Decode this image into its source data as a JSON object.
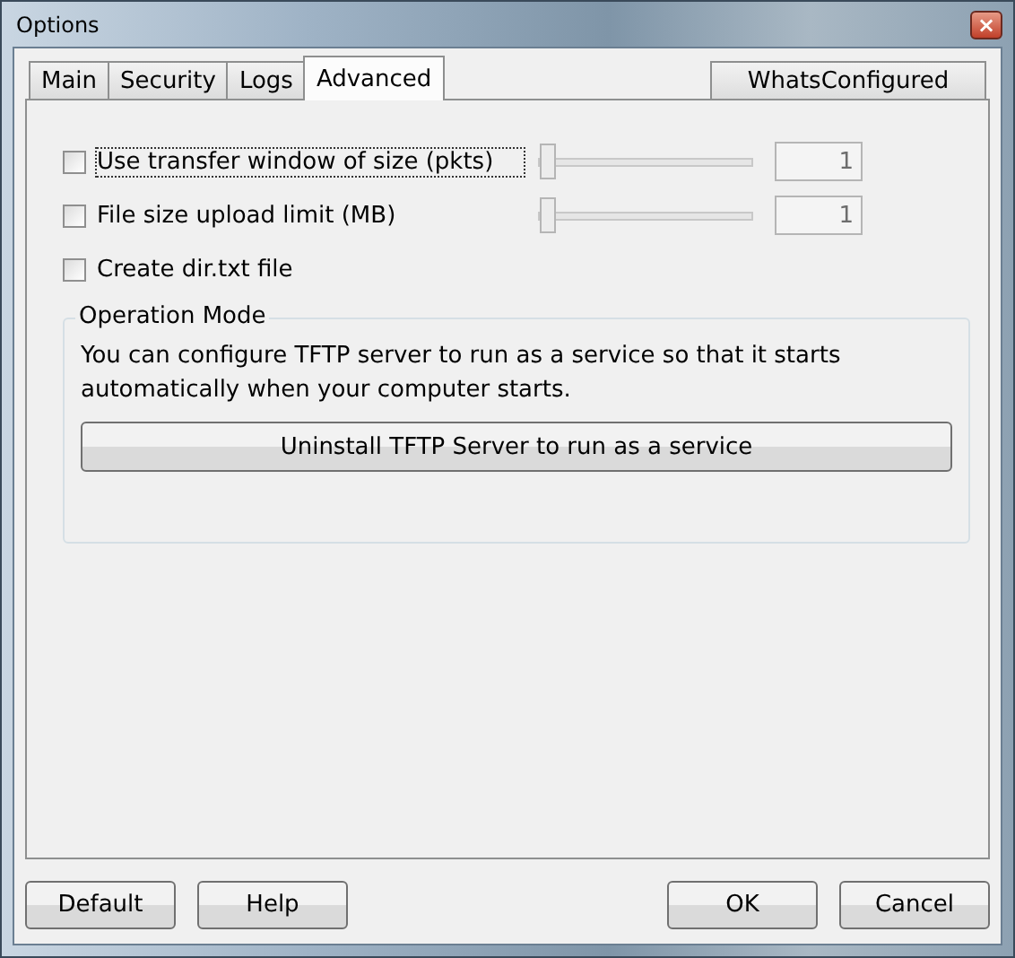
{
  "window": {
    "title": "Options",
    "close": "×"
  },
  "tabs": [
    {
      "label": "Main",
      "selected": false
    },
    {
      "label": "Security",
      "selected": false
    },
    {
      "label": "Logs",
      "selected": false
    },
    {
      "label": "Advanced",
      "selected": true
    }
  ],
  "whats_configured": "WhatsConfigured",
  "options": [
    {
      "kind": "slider",
      "label": "Use transfer window of size (pkts)",
      "checked": false,
      "focused": true,
      "level": 0,
      "value": "1"
    },
    {
      "kind": "slider",
      "label": "File size upload limit (MB)",
      "checked": false,
      "focused": false,
      "level": 0,
      "value": "1"
    },
    {
      "kind": "plain",
      "label": "Create dir.txt file",
      "checked": false,
      "focused": false
    }
  ],
  "operation_mode": {
    "title": "Operation Mode",
    "text": "You can configure TFTP server to run as a service so that it starts automatically when your computer starts.",
    "button": "Uninstall TFTP Server to run as a service"
  },
  "buttons": {
    "left": [
      "Default",
      "Help"
    ],
    "right": [
      "OK",
      "Cancel"
    ]
  }
}
